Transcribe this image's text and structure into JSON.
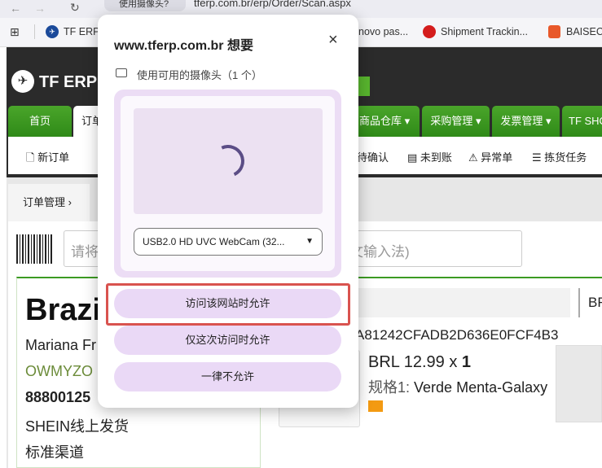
{
  "browser": {
    "tab_label": "使用摄像头?",
    "url": "tferp.com.br/erp/Order/Scan.aspx",
    "bookmarks": [
      {
        "label": "TF ERP",
        "icon": "tf-logo-icon"
      },
      {
        "label": "novo pas...",
        "icon": ""
      },
      {
        "label": "Shipment Trackin...",
        "icon": "shipment-icon"
      },
      {
        "label": "BAISEC",
        "icon": "baisec-icon"
      }
    ]
  },
  "erp": {
    "logo_text": "TF ERP",
    "tabs": [
      "首页",
      "订单",
      "商品仓库",
      "采购管理",
      "发票管理",
      "TF SHO"
    ],
    "sub_nav": [
      "新订单",
      "待确认",
      "未到账",
      "异常单",
      "拣货任务"
    ],
    "breadcrumb": "订单管理",
    "scan_placeholder": "请将",
    "scan_hint": "文输入法)",
    "order": {
      "country": "Brazi",
      "customer_name": "Mariana Fr",
      "customer_code": "OWMYZO",
      "phone": "88800125",
      "platform": "SHEIN线上发货",
      "channel": "标准渠道",
      "sku": "A81242CFADB2D636E0FCF4B3",
      "price": "BRL 12.99",
      "qty_prefix": "x",
      "qty": "1",
      "spec_label": "规格1:",
      "spec_value": "Verde Menta-Galaxy",
      "right_label": "BR"
    }
  },
  "popup": {
    "title": "www.tferp.com.br 想要",
    "permission": "使用可用的摄像头（1 个）",
    "camera_select": "USB2.0 HD UVC WebCam (32...",
    "buttons": {
      "allow_site": "访问该网站时允许",
      "allow_once": "仅这次访问时允许",
      "never": "一律不允许"
    }
  },
  "colors": {
    "accent_green": "#3c9b22",
    "popup_button": "#ead9f6",
    "highlight": "#d9534f"
  }
}
